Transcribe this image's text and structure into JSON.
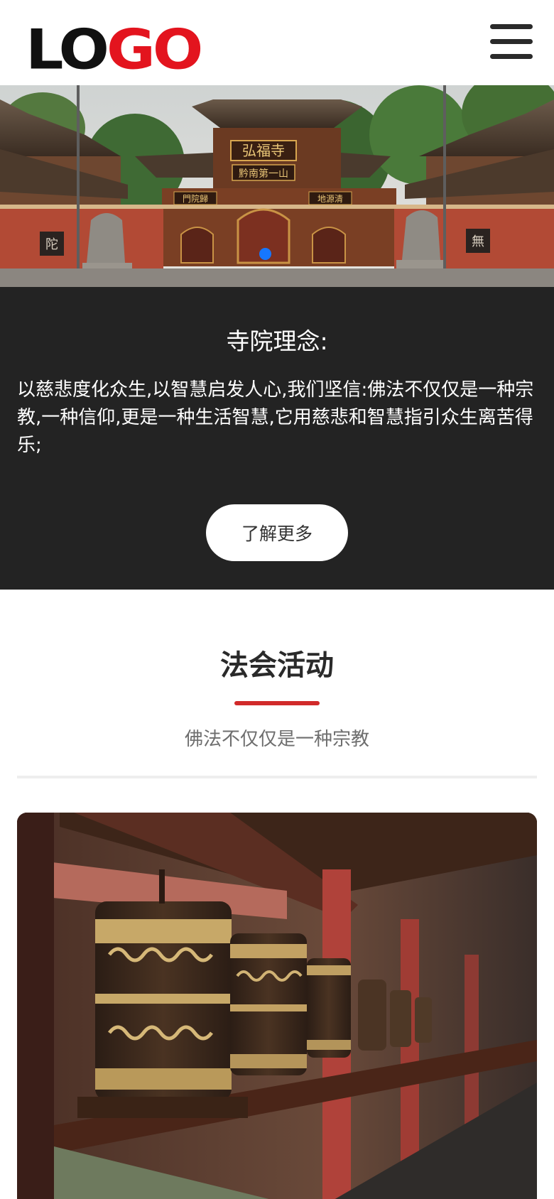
{
  "header": {
    "logo_part1": "LO",
    "logo_part2": "GO",
    "menu_icon": "hamburger-menu-icon"
  },
  "hero": {
    "plaque_main": "弘福寺",
    "plaque_sub": "黔南第一山",
    "plaque_left": "門院歸",
    "plaque_right": "地源清",
    "wall_char_left": "陀",
    "wall_char_right": "無",
    "slider_active_dot_color": "#1677ff"
  },
  "philosophy": {
    "title": "寺院理念:",
    "text": "以慈悲度化众生,以智慧启发人心,我们坚信:佛法不仅仅是一种宗教,一种信仰,更是一种生活智慧,它用慈悲和智慧指引众生离苦得乐;",
    "button_label": "了解更多"
  },
  "activities": {
    "title": "法会活动",
    "subtitle": "佛法不仅仅是一种宗教",
    "accent_color": "#d12a2a"
  },
  "colors": {
    "logo_red": "#e3141e",
    "dark_section": "#232323"
  }
}
